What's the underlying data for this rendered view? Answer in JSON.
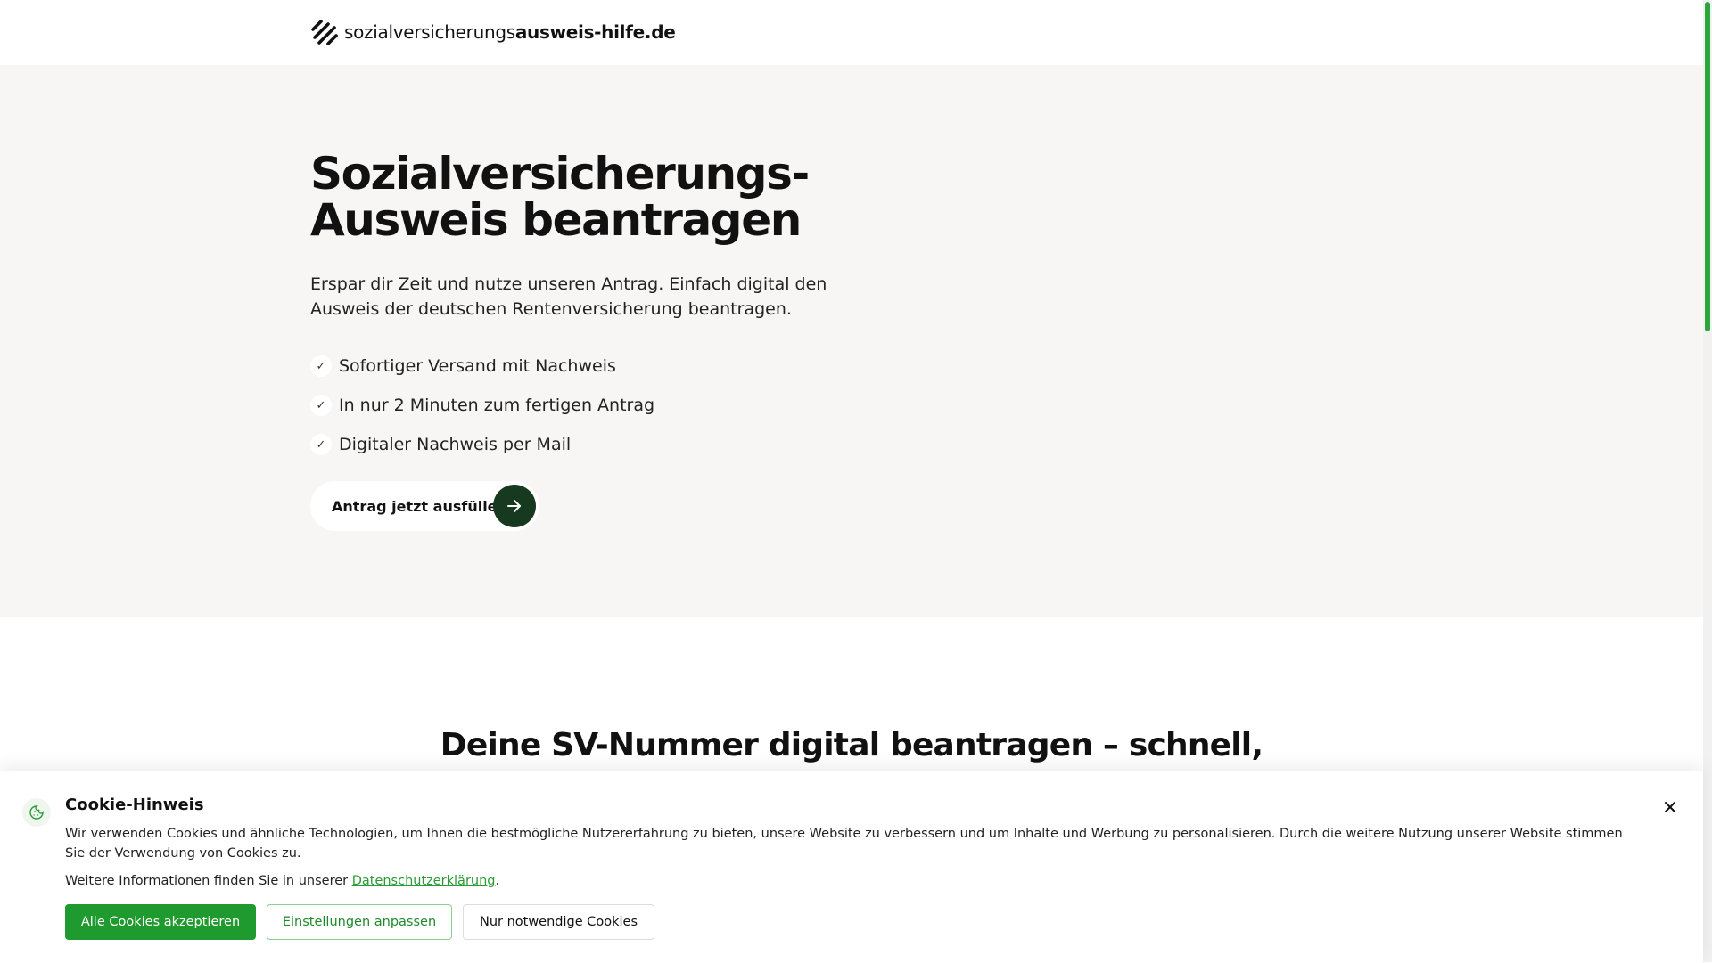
{
  "header": {
    "logo_light": "sozialversicherungs",
    "logo_bold": "ausweis-hilfe.de"
  },
  "hero": {
    "title_line1": "Sozialversicherungs-",
    "title_line2": "Ausweis beantragen",
    "subtitle": "Erspar dir Zeit und nutze unseren Antrag. Einfach digital den Ausweis der deutschen Rentenversicherung beantragen.",
    "features": [
      {
        "label": "Sofortiger Versand mit Nachweis"
      },
      {
        "label": "In nur 2 Minuten zum fertigen Antrag"
      },
      {
        "label": "Digitaler Nachweis per Mail"
      }
    ],
    "cta_label": "Antrag jetzt ausfüllen"
  },
  "section2": {
    "title": "Deine SV-Nummer digital beantragen – schnell,"
  },
  "cookie": {
    "title": "Cookie-Hinweis",
    "text": "Wir verwenden Cookies und ähnliche Technologien, um Ihnen die bestmögliche Nutzererfahrung zu bieten, unsere Website zu verbessern und um Inhalte und Werbung zu personalisieren. Durch die weitere Nutzung unserer Website stimmen Sie der Verwendung von Cookies zu.",
    "more_prefix": "Weitere Informationen finden Sie in unserer ",
    "privacy_link": "Datenschutzerklärung",
    "more_suffix": ".",
    "accept_all": "Alle Cookies akzeptieren",
    "customize": "Einstellungen anpassen",
    "necessary_only": "Nur notwendige Cookies"
  },
  "colors": {
    "accent_green": "#1f9a2e",
    "cta_arrow_bg": "#17391f",
    "hero_bg": "#f7f6f5"
  },
  "icons": [
    "logo-mark-icon",
    "check-icon",
    "arrow-right-icon",
    "cookie-icon",
    "close-icon"
  ]
}
